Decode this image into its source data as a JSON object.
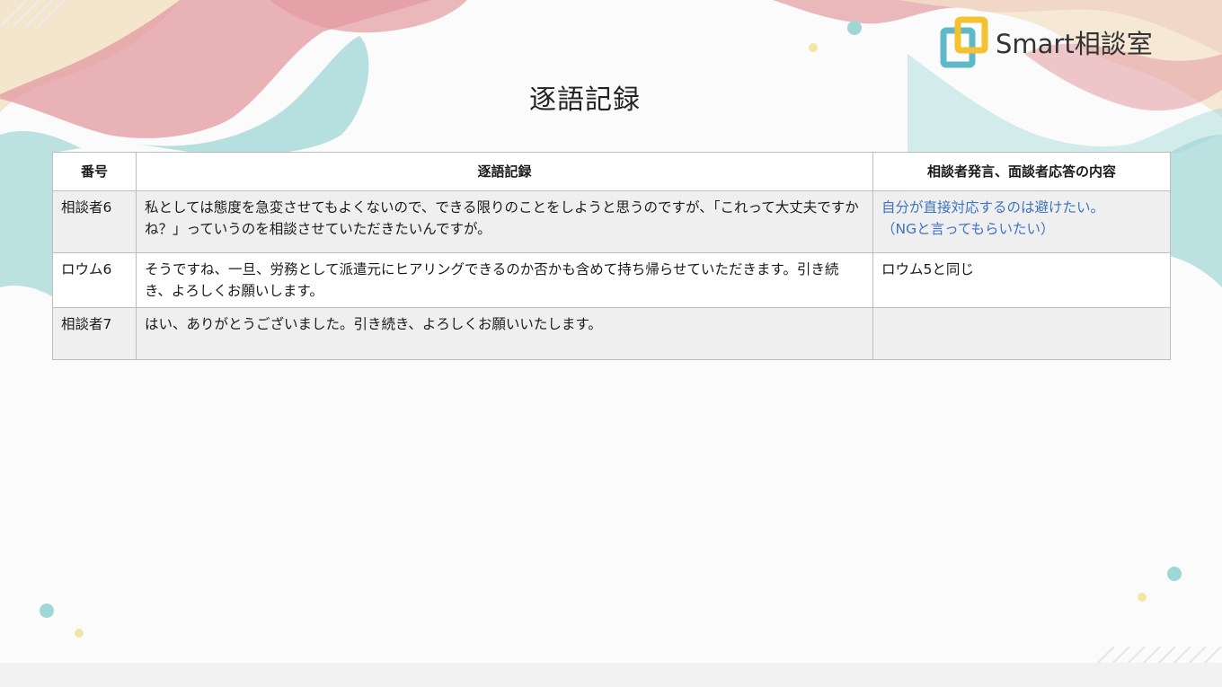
{
  "logo": {
    "text": "Smart相談室",
    "icon": "s-square-logo-icon",
    "colors": {
      "teal": "#5fb8c8",
      "yellow": "#f2c231"
    }
  },
  "page": {
    "title": "逐語記録"
  },
  "table": {
    "headers": {
      "number": "番号",
      "transcript": "逐語記録",
      "content": "相談者発言、面談者応答の内容"
    },
    "rows": [
      {
        "number": "相談者6",
        "transcript": "私としては態度を急変させてもよくないので、できる限りのことをしようと思うのですが、「これって大丈夫ですかね？」っていうのを相談させていただきたいんですが。",
        "content_line1": "自分が直接対応するのは避けたい。",
        "content_line2": "（NGと言ってもらいたい）"
      },
      {
        "number": "ロウム6",
        "transcript": "そうですね、一旦、労務として派遣元にヒアリングできるのか否かも含めて持ち帰らせていただきます。引き続き、よろしくお願いします。",
        "content": "ロウム5と同じ"
      },
      {
        "number": "相談者7",
        "transcript": "はい、ありがとうございました。引き続き、よろしくお願いいたします。",
        "content": ""
      }
    ]
  },
  "colors": {
    "highlight_text": "#3d74c4",
    "row_shade": "#efefef",
    "border": "#bdbdbd",
    "wave_pink": "#e39aa0",
    "wave_teal": "#9fd6d6",
    "wave_cream": "#f3e2c8"
  }
}
